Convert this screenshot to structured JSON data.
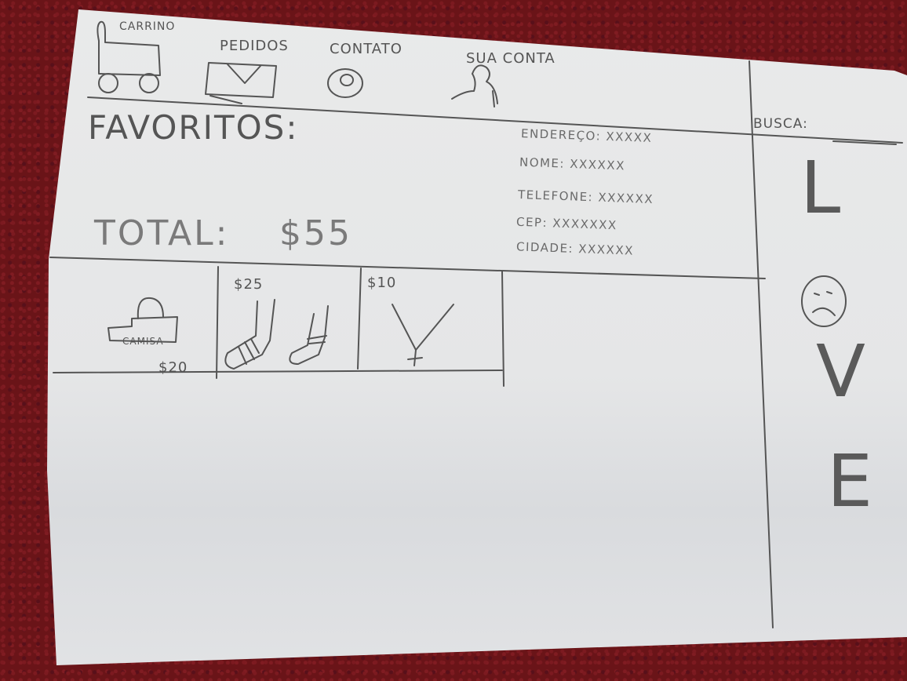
{
  "nav": {
    "carrinho": "CARRINO",
    "pedidos": "PEDIDOS",
    "contato": "CONTATO",
    "sua_conta": "SUA CONTA"
  },
  "favoritos": {
    "title": "FAVORITOS:"
  },
  "total": {
    "label": "TOTAL:",
    "value": "$55"
  },
  "user_info": {
    "endereco": "ENDEREÇO: XXXXX",
    "nome": "NOME: XXXXXX",
    "telefone": "TELEFONE: XXXXXX",
    "cep": "CEP: XXXXXXX",
    "cidade": "CIDADE: XXXXXX"
  },
  "products": [
    {
      "name": "CAMISA",
      "price": "$20"
    },
    {
      "name": "",
      "price": "$25"
    },
    {
      "name": "",
      "price": "$10"
    }
  ],
  "search": {
    "label": "BUSCA:"
  },
  "side_banner": {
    "letters": [
      "L",
      "O",
      "V",
      "E"
    ]
  }
}
